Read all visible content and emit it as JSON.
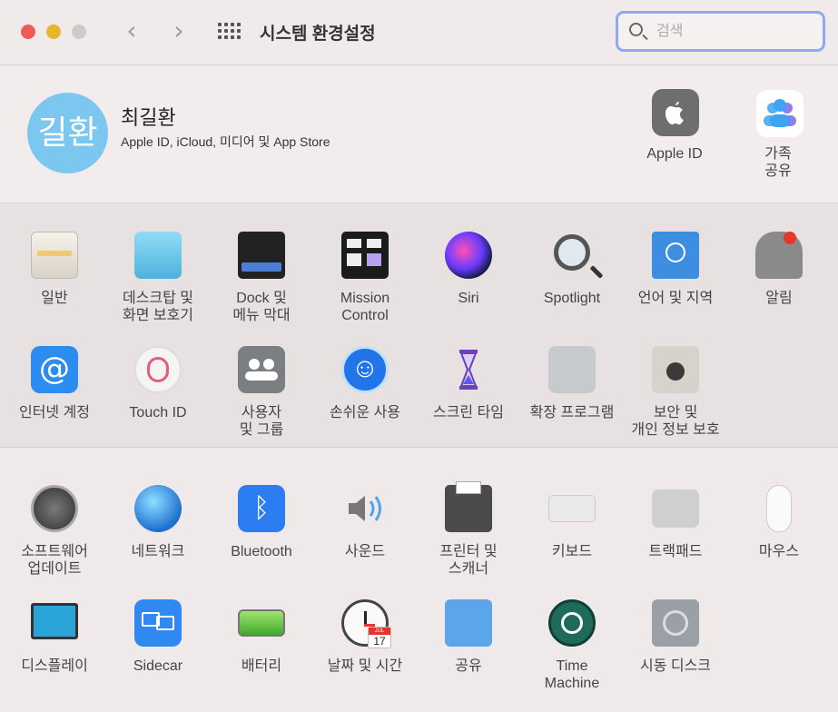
{
  "window": {
    "title": "시스템 환경설정",
    "search_placeholder": "검색"
  },
  "profile": {
    "avatar_text": "길환",
    "name": "최길환",
    "subtitle": "Apple ID, iCloud, 미디어 및 App Store",
    "apple_id_label": "Apple ID",
    "family_label_line1": "가족",
    "family_label_line2": "공유"
  },
  "panes_row1": [
    {
      "label1": "일반",
      "label2": "",
      "icon": "general-icon"
    },
    {
      "label1": "데스크탑 및",
      "label2": "화면 보호기",
      "icon": "desktop-icon"
    },
    {
      "label1": "Dock 및",
      "label2": "메뉴 막대",
      "icon": "dock-icon"
    },
    {
      "label1": "Mission",
      "label2": "Control",
      "icon": "mission-control-icon"
    },
    {
      "label1": "Siri",
      "label2": "",
      "icon": "siri-icon"
    },
    {
      "label1": "Spotlight",
      "label2": "",
      "icon": "spotlight-icon"
    },
    {
      "label1": "언어 및 지역",
      "label2": "",
      "icon": "language-icon"
    },
    {
      "label1": "알림",
      "label2": "",
      "icon": "bell-icon"
    }
  ],
  "panes_row2": [
    {
      "label1": "인터넷 계정",
      "label2": "",
      "icon": "at-icon"
    },
    {
      "label1": "Touch ID",
      "label2": "",
      "icon": "fingerprint-icon"
    },
    {
      "label1": "사용자",
      "label2": "및 그룹",
      "icon": "users-icon"
    },
    {
      "label1": "손쉬운 사용",
      "label2": "",
      "icon": "accessibility-icon"
    },
    {
      "label1": "스크린 타임",
      "label2": "",
      "icon": "hourglass-icon"
    },
    {
      "label1": "확장 프로그램",
      "label2": "",
      "icon": "puzzle-icon"
    },
    {
      "label1": "보안 및",
      "label2": "개인 정보 보호",
      "icon": "house-lock-icon"
    }
  ],
  "panes_row3": [
    {
      "label1": "소프트웨어",
      "label2": "업데이트",
      "icon": "gear-icon"
    },
    {
      "label1": "네트워크",
      "label2": "",
      "icon": "globe-icon"
    },
    {
      "label1": "Bluetooth",
      "label2": "",
      "icon": "bluetooth-icon"
    },
    {
      "label1": "사운드",
      "label2": "",
      "icon": "speaker-icon"
    },
    {
      "label1": "프린터 및",
      "label2": "스캐너",
      "icon": "printer-icon"
    },
    {
      "label1": "키보드",
      "label2": "",
      "icon": "keyboard-icon"
    },
    {
      "label1": "트랙패드",
      "label2": "",
      "icon": "trackpad-icon"
    },
    {
      "label1": "마우스",
      "label2": "",
      "icon": "mouse-icon"
    }
  ],
  "panes_row4": [
    {
      "label1": "디스플레이",
      "label2": "",
      "icon": "display-icon"
    },
    {
      "label1": "Sidecar",
      "label2": "",
      "icon": "sidecar-icon"
    },
    {
      "label1": "배터리",
      "label2": "",
      "icon": "battery-icon"
    },
    {
      "label1": "날짜 및 시간",
      "label2": "",
      "icon": "clock-icon"
    },
    {
      "label1": "공유",
      "label2": "",
      "icon": "sharing-folder-icon"
    },
    {
      "label1": "Time",
      "label2": "Machine",
      "icon": "time-machine-icon"
    },
    {
      "label1": "시동 디스크",
      "label2": "",
      "icon": "disk-icon"
    }
  ],
  "calendar": {
    "month": "JUL",
    "day": "17"
  },
  "colors": {
    "accent": "#8fa9ee",
    "background": "#efe8e8",
    "notification": "#e8352c"
  }
}
